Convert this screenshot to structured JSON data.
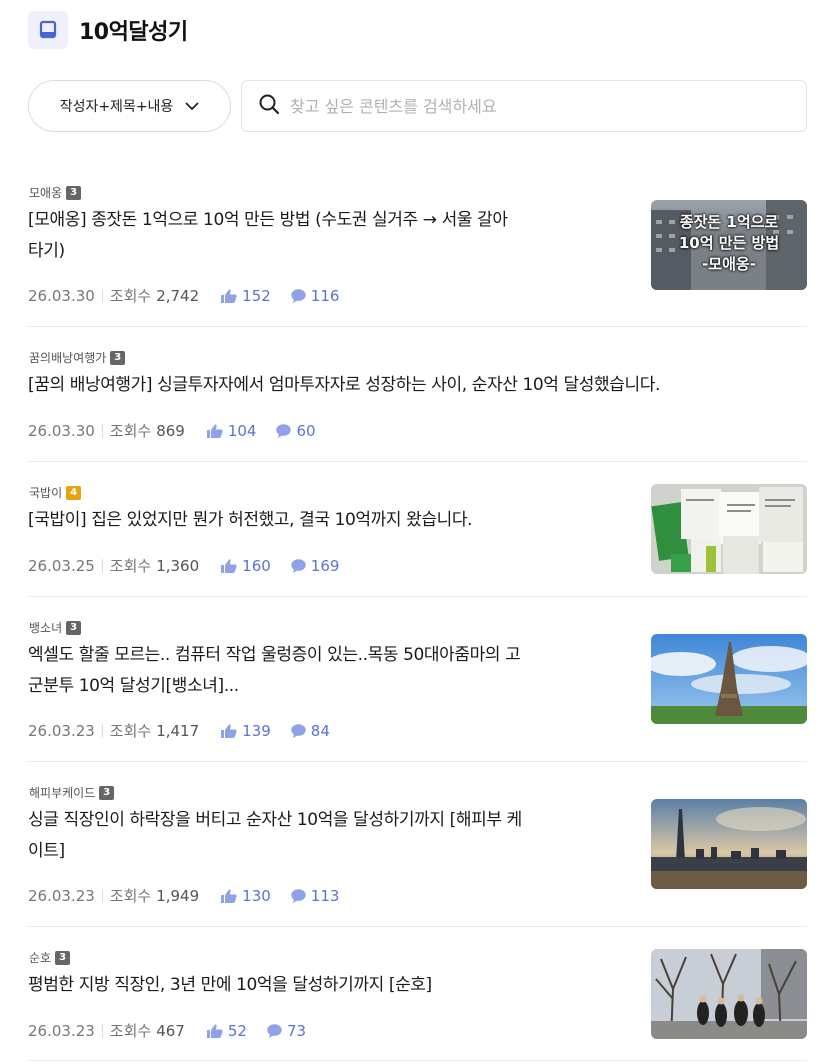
{
  "header": {
    "title": "10억달성기",
    "icon": "book-icon"
  },
  "search": {
    "filter_label": "작성자+제목+내용",
    "placeholder": "찾고 싶은 콘텐츠를 검색하세요"
  },
  "colors": {
    "accent": "#5a73d8",
    "level3": "#666666",
    "level4": "#e3a60f"
  },
  "posts": [
    {
      "author": "모애옹",
      "level": "3",
      "title_line1": "[모애옹] 종잣돈 1억으로 10억 만든 방법 (수도권 실거주 → 서울 갈아",
      "title_line2": "타기)",
      "date": "26.03.30",
      "views_label": "조회수",
      "views": "2,742",
      "likes": "152",
      "comments": "116",
      "thumb_caption": [
        "종잣돈 1억으로",
        "10억 만든 방법",
        "-모애옹-"
      ]
    },
    {
      "author": "꿈의배낭여행가",
      "level": "3",
      "title_line1": "[꿈의 배낭여행가] 싱글투자자에서 엄마투자자로 성장하는 사이, 순자산 10억 달성했습니다.",
      "title_line2": "",
      "date": "26.03.30",
      "views_label": "조회수",
      "views": "869",
      "likes": "104",
      "comments": "60"
    },
    {
      "author": "국밥이",
      "level": "4",
      "title_line1": "[국밥이] 집은 있었지만 뭔가 허전했고, 결국 10억까지 왔습니다.",
      "title_line2": "",
      "date": "26.03.25",
      "views_label": "조회수",
      "views": "1,360",
      "likes": "160",
      "comments": "169"
    },
    {
      "author": "뱅소녀",
      "level": "3",
      "title_line1": "엑셀도 할줄 모르는.. 컴퓨터 작업 울렁증이 있는..목동 50대아줌마의 고",
      "title_line2": "군분투 10억 달성기[뱅소녀]...",
      "date": "26.03.23",
      "views_label": "조회수",
      "views": "1,417",
      "likes": "139",
      "comments": "84"
    },
    {
      "author": "해피부케이드",
      "level": "3",
      "title_line1": "싱글 직장인이 하락장을 버티고 순자산 10억을 달성하기까지 [해피부 케",
      "title_line2": "이트]",
      "date": "26.03.23",
      "views_label": "조회수",
      "views": "1,949",
      "likes": "130",
      "comments": "113"
    },
    {
      "author": "순호",
      "level": "3",
      "title_line1": "평범한 지방 직장인, 3년 만에 10억을 달성하기까지 [순호]",
      "title_line2": "",
      "date": "26.03.23",
      "views_label": "조회수",
      "views": "467",
      "likes": "52",
      "comments": "73"
    }
  ]
}
